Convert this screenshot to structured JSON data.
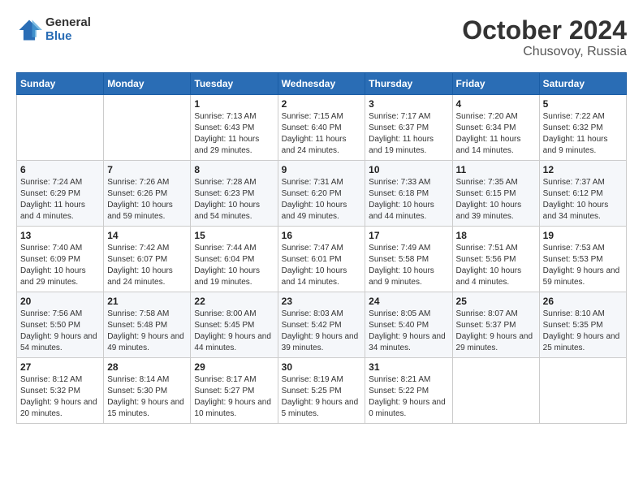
{
  "logo": {
    "general": "General",
    "blue": "Blue"
  },
  "header": {
    "month": "October 2024",
    "location": "Chusovoy, Russia"
  },
  "weekdays": [
    "Sunday",
    "Monday",
    "Tuesday",
    "Wednesday",
    "Thursday",
    "Friday",
    "Saturday"
  ],
  "weeks": [
    [
      {
        "day": "",
        "sunrise": "",
        "sunset": "",
        "daylight": "",
        "empty": true
      },
      {
        "day": "",
        "sunrise": "",
        "sunset": "",
        "daylight": "",
        "empty": true
      },
      {
        "day": "1",
        "sunrise": "Sunrise: 7:13 AM",
        "sunset": "Sunset: 6:43 PM",
        "daylight": "Daylight: 11 hours and 29 minutes."
      },
      {
        "day": "2",
        "sunrise": "Sunrise: 7:15 AM",
        "sunset": "Sunset: 6:40 PM",
        "daylight": "Daylight: 11 hours and 24 minutes."
      },
      {
        "day": "3",
        "sunrise": "Sunrise: 7:17 AM",
        "sunset": "Sunset: 6:37 PM",
        "daylight": "Daylight: 11 hours and 19 minutes."
      },
      {
        "day": "4",
        "sunrise": "Sunrise: 7:20 AM",
        "sunset": "Sunset: 6:34 PM",
        "daylight": "Daylight: 11 hours and 14 minutes."
      },
      {
        "day": "5",
        "sunrise": "Sunrise: 7:22 AM",
        "sunset": "Sunset: 6:32 PM",
        "daylight": "Daylight: 11 hours and 9 minutes."
      }
    ],
    [
      {
        "day": "6",
        "sunrise": "Sunrise: 7:24 AM",
        "sunset": "Sunset: 6:29 PM",
        "daylight": "Daylight: 11 hours and 4 minutes."
      },
      {
        "day": "7",
        "sunrise": "Sunrise: 7:26 AM",
        "sunset": "Sunset: 6:26 PM",
        "daylight": "Daylight: 10 hours and 59 minutes."
      },
      {
        "day": "8",
        "sunrise": "Sunrise: 7:28 AM",
        "sunset": "Sunset: 6:23 PM",
        "daylight": "Daylight: 10 hours and 54 minutes."
      },
      {
        "day": "9",
        "sunrise": "Sunrise: 7:31 AM",
        "sunset": "Sunset: 6:20 PM",
        "daylight": "Daylight: 10 hours and 49 minutes."
      },
      {
        "day": "10",
        "sunrise": "Sunrise: 7:33 AM",
        "sunset": "Sunset: 6:18 PM",
        "daylight": "Daylight: 10 hours and 44 minutes."
      },
      {
        "day": "11",
        "sunrise": "Sunrise: 7:35 AM",
        "sunset": "Sunset: 6:15 PM",
        "daylight": "Daylight: 10 hours and 39 minutes."
      },
      {
        "day": "12",
        "sunrise": "Sunrise: 7:37 AM",
        "sunset": "Sunset: 6:12 PM",
        "daylight": "Daylight: 10 hours and 34 minutes."
      }
    ],
    [
      {
        "day": "13",
        "sunrise": "Sunrise: 7:40 AM",
        "sunset": "Sunset: 6:09 PM",
        "daylight": "Daylight: 10 hours and 29 minutes."
      },
      {
        "day": "14",
        "sunrise": "Sunrise: 7:42 AM",
        "sunset": "Sunset: 6:07 PM",
        "daylight": "Daylight: 10 hours and 24 minutes."
      },
      {
        "day": "15",
        "sunrise": "Sunrise: 7:44 AM",
        "sunset": "Sunset: 6:04 PM",
        "daylight": "Daylight: 10 hours and 19 minutes."
      },
      {
        "day": "16",
        "sunrise": "Sunrise: 7:47 AM",
        "sunset": "Sunset: 6:01 PM",
        "daylight": "Daylight: 10 hours and 14 minutes."
      },
      {
        "day": "17",
        "sunrise": "Sunrise: 7:49 AM",
        "sunset": "Sunset: 5:58 PM",
        "daylight": "Daylight: 10 hours and 9 minutes."
      },
      {
        "day": "18",
        "sunrise": "Sunrise: 7:51 AM",
        "sunset": "Sunset: 5:56 PM",
        "daylight": "Daylight: 10 hours and 4 minutes."
      },
      {
        "day": "19",
        "sunrise": "Sunrise: 7:53 AM",
        "sunset": "Sunset: 5:53 PM",
        "daylight": "Daylight: 9 hours and 59 minutes."
      }
    ],
    [
      {
        "day": "20",
        "sunrise": "Sunrise: 7:56 AM",
        "sunset": "Sunset: 5:50 PM",
        "daylight": "Daylight: 9 hours and 54 minutes."
      },
      {
        "day": "21",
        "sunrise": "Sunrise: 7:58 AM",
        "sunset": "Sunset: 5:48 PM",
        "daylight": "Daylight: 9 hours and 49 minutes."
      },
      {
        "day": "22",
        "sunrise": "Sunrise: 8:00 AM",
        "sunset": "Sunset: 5:45 PM",
        "daylight": "Daylight: 9 hours and 44 minutes."
      },
      {
        "day": "23",
        "sunrise": "Sunrise: 8:03 AM",
        "sunset": "Sunset: 5:42 PM",
        "daylight": "Daylight: 9 hours and 39 minutes."
      },
      {
        "day": "24",
        "sunrise": "Sunrise: 8:05 AM",
        "sunset": "Sunset: 5:40 PM",
        "daylight": "Daylight: 9 hours and 34 minutes."
      },
      {
        "day": "25",
        "sunrise": "Sunrise: 8:07 AM",
        "sunset": "Sunset: 5:37 PM",
        "daylight": "Daylight: 9 hours and 29 minutes."
      },
      {
        "day": "26",
        "sunrise": "Sunrise: 8:10 AM",
        "sunset": "Sunset: 5:35 PM",
        "daylight": "Daylight: 9 hours and 25 minutes."
      }
    ],
    [
      {
        "day": "27",
        "sunrise": "Sunrise: 8:12 AM",
        "sunset": "Sunset: 5:32 PM",
        "daylight": "Daylight: 9 hours and 20 minutes."
      },
      {
        "day": "28",
        "sunrise": "Sunrise: 8:14 AM",
        "sunset": "Sunset: 5:30 PM",
        "daylight": "Daylight: 9 hours and 15 minutes."
      },
      {
        "day": "29",
        "sunrise": "Sunrise: 8:17 AM",
        "sunset": "Sunset: 5:27 PM",
        "daylight": "Daylight: 9 hours and 10 minutes."
      },
      {
        "day": "30",
        "sunrise": "Sunrise: 8:19 AM",
        "sunset": "Sunset: 5:25 PM",
        "daylight": "Daylight: 9 hours and 5 minutes."
      },
      {
        "day": "31",
        "sunrise": "Sunrise: 8:21 AM",
        "sunset": "Sunset: 5:22 PM",
        "daylight": "Daylight: 9 hours and 0 minutes."
      },
      {
        "day": "",
        "sunrise": "",
        "sunset": "",
        "daylight": "",
        "empty": true
      },
      {
        "day": "",
        "sunrise": "",
        "sunset": "",
        "daylight": "",
        "empty": true
      }
    ]
  ]
}
